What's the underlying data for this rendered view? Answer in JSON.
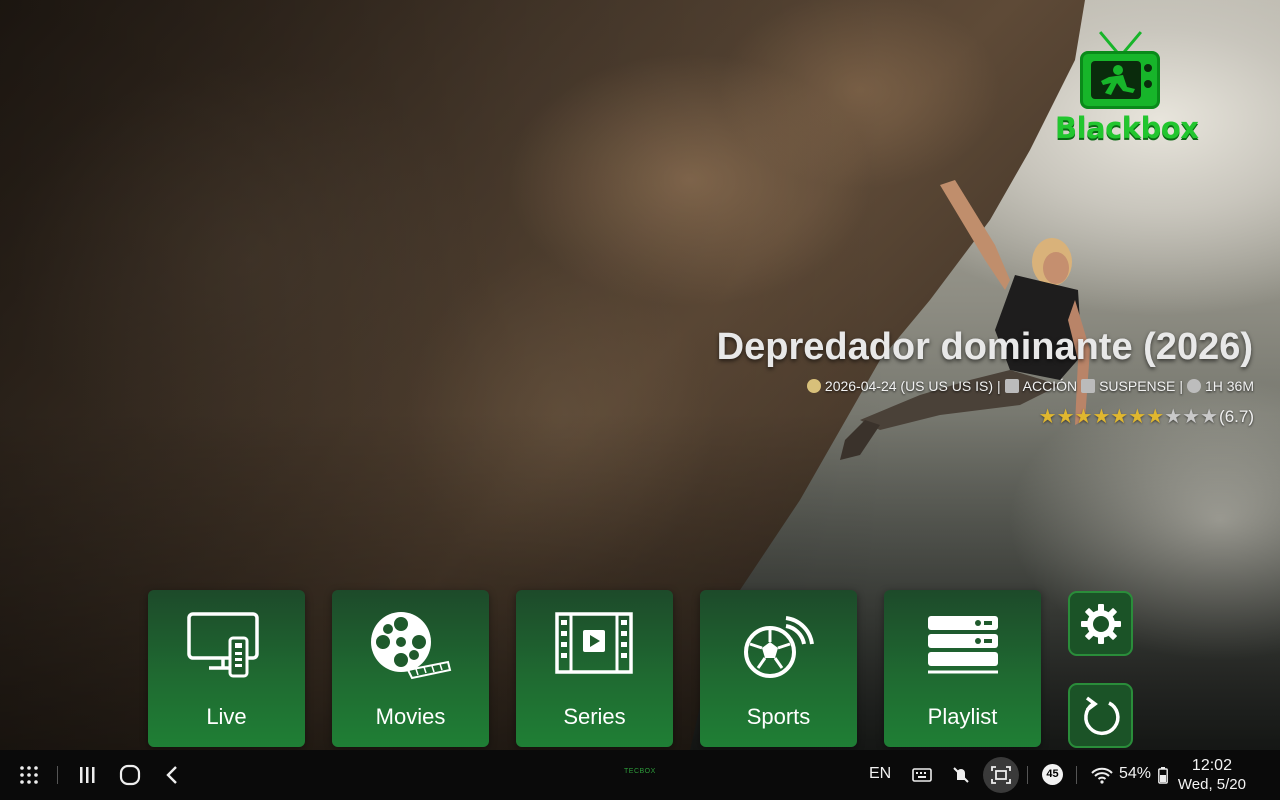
{
  "app": {
    "logo_text": "Blackbox",
    "accent_color": "#1f7f35",
    "logo_color": "#22c62f"
  },
  "featured": {
    "title": "Depredador dominante (2026)",
    "release": "2026-04-24 (US US US IS)",
    "genres": [
      "ACCIÓN",
      "SUSPENSE"
    ],
    "duration": "1H 36M",
    "separator": "|",
    "rating_value": "(6.7)",
    "stars_filled": 7,
    "stars_total": 10
  },
  "menu": {
    "tiles": [
      {
        "label": "Live",
        "icon": "tv-remote-icon"
      },
      {
        "label": "Movies",
        "icon": "film-reel-icon"
      },
      {
        "label": "Series",
        "icon": "film-strip-play-icon"
      },
      {
        "label": "Sports",
        "icon": "soccer-ball-icon"
      },
      {
        "label": "Playlist",
        "icon": "playlist-server-icon"
      }
    ],
    "side_buttons": [
      {
        "name": "settings",
        "icon": "gear-icon"
      },
      {
        "name": "refresh",
        "icon": "refresh-icon"
      }
    ]
  },
  "system_bar": {
    "center_logo": "TECBOX",
    "language": "EN",
    "notification_count": "45",
    "battery": "54%",
    "time": "12:02",
    "date": "Wed, 5/20"
  }
}
